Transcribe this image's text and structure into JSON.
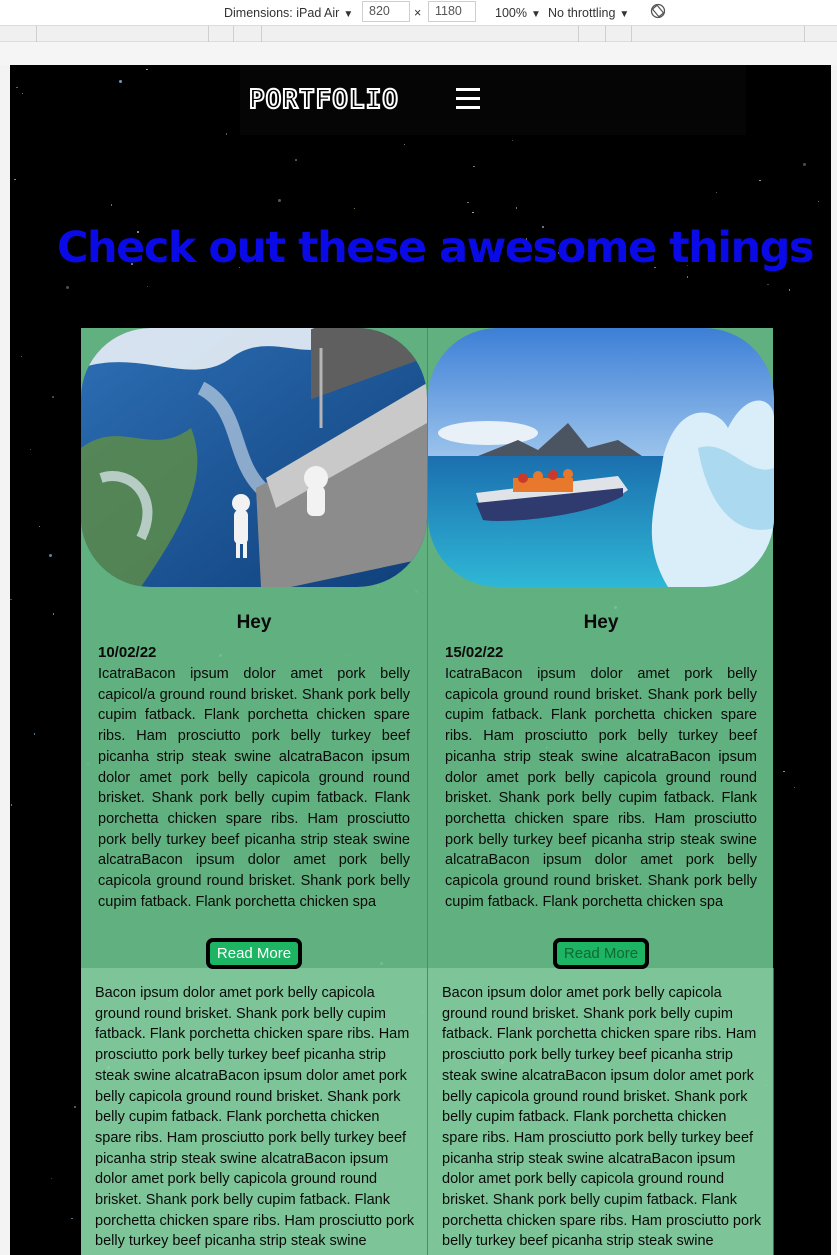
{
  "devtools": {
    "dimensions_label": "Dimensions: iPad Air",
    "width_value": "820",
    "times": "×",
    "height_value": "1180",
    "zoom": "100%",
    "throttling": "No throttling",
    "caret": "▼",
    "rotate_icon": "rotate-icon"
  },
  "page": {
    "logo": "PORTFOLIO",
    "heading": "Check out these awesome things",
    "colors": {
      "heading": "#0a0ae6",
      "card_bg": "#6ec891",
      "button": "#1db463"
    },
    "cards": [
      {
        "image": "astronaut-spacewalk-image",
        "title": "Hey",
        "date": "10/02/22",
        "text": "IcatraBacon ipsum dolor amet pork belly capicol/a ground round brisket. Shank pork belly cupim fatback. Flank porchetta chicken spare ribs. Ham prosciutto pork belly turkey beef picanha strip steak swine alcatraBacon ipsum dolor amet pork belly capicola ground round brisket. Shank pork belly cupim fatback. Flank porchetta chicken spare ribs. Ham prosciutto pork belly turkey beef picanha strip steak swine alcatraBacon ipsum dolor amet pork belly capicola ground round brisket. Shank pork belly cupim fatback. Flank porchetta chicken spa",
        "button": "Read More",
        "more_text": "Bacon ipsum dolor amet pork belly capicola ground round brisket. Shank pork belly cupim fatback. Flank porchetta chicken spare ribs. Ham prosciutto pork belly turkey beef picanha strip steak swine alcatraBacon ipsum dolor amet pork belly capicola ground round brisket. Shank pork belly cupim fatback. Flank porchetta chicken spare ribs. Ham prosciutto pork belly turkey beef picanha strip steak swine alcatraBacon ipsum dolor amet pork belly capicola ground round brisket. Shank pork belly cupim fatback. Flank porchetta chicken spare ribs. Ham prosciutto pork belly turkey beef picanha strip steak swine alcatraBacon ipsum"
      },
      {
        "image": "iceberg-boat-image",
        "title": "Hey",
        "date": "15/02/22",
        "text": "IcatraBacon ipsum dolor amet pork belly capicola ground round brisket. Shank pork belly cupim fatback. Flank porchetta chicken spare ribs. Ham prosciutto pork belly turkey beef picanha strip steak swine alcatraBacon ipsum dolor amet pork belly capicola ground round brisket. Shank pork belly cupim fatback. Flank porchetta chicken spare ribs. Ham prosciutto pork belly turkey beef picanha strip steak swine alcatraBacon ipsum dolor amet pork belly capicola ground round brisket. Shank pork belly cupim fatback. Flank porchetta chicken spa",
        "button": "Read More",
        "more_text": "Bacon ipsum dolor amet pork belly capicola ground round brisket. Shank pork belly cupim fatback. Flank porchetta chicken spare ribs. Ham prosciutto pork belly turkey beef picanha strip steak swine alcatraBacon ipsum dolor amet pork belly capicola ground round brisket. Shank pork belly cupim fatback. Flank porchetta chicken spare ribs. Ham prosciutto pork belly turkey beef picanha strip steak swine alcatraBacon ipsum dolor amet pork belly capicola ground round brisket. Shank pork belly cupim fatback. Flank porchetta chicken spare ribs. Ham prosciutto pork belly turkey beef picanha strip steak swine alcatraBacon ipsum"
      }
    ]
  }
}
